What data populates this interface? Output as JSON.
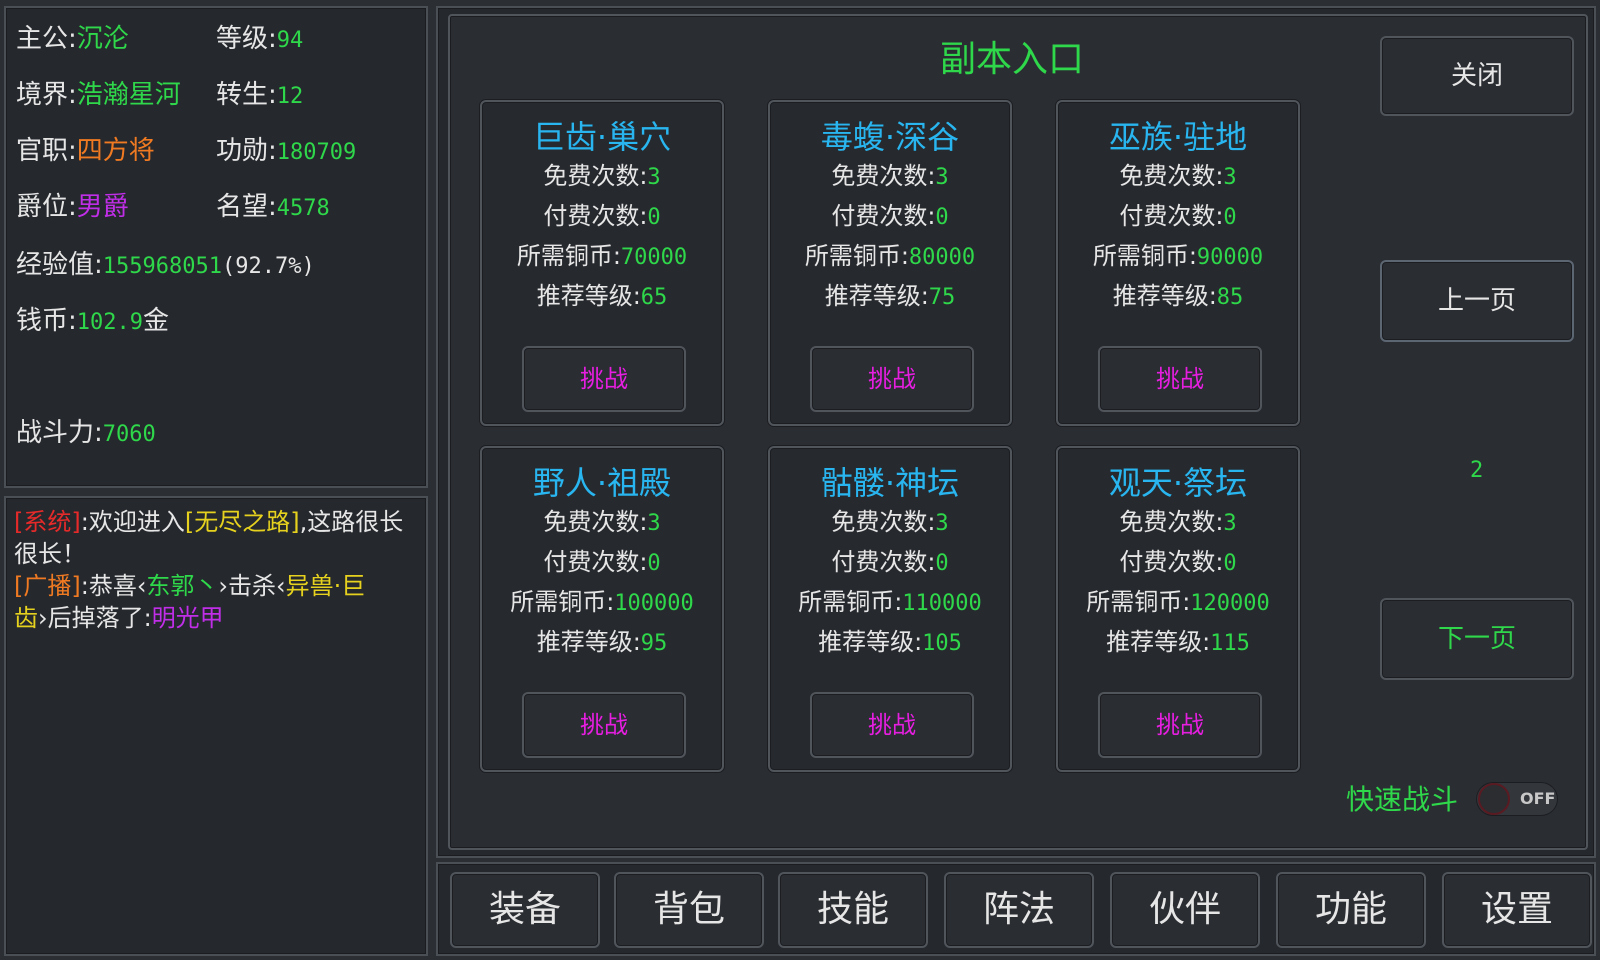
{
  "stats": {
    "lord_label": "主公:",
    "lord_value": "沉沦",
    "level_label": "等级:",
    "level_value": "94",
    "realm_label": "境界:",
    "realm_value": "浩瀚星河",
    "rebirth_label": "转生:",
    "rebirth_value": "12",
    "office_label": "官职:",
    "office_value": "四方将",
    "merit_label": "功勋:",
    "merit_value": "180709",
    "rank_label": "爵位:",
    "rank_value": "男爵",
    "fame_label": "名望:",
    "fame_value": "4578",
    "exp_label": "经验值:",
    "exp_value": "155968051",
    "exp_percent": "(92.7%)",
    "coin_label": "钱币:",
    "coin_value": "102.9",
    "coin_unit": "金",
    "power_label": "战斗力:",
    "power_value": "7060"
  },
  "chat": {
    "m1_tag": "[系统]",
    "m1_a": ":欢迎进入",
    "m1_hl": "[无尽之路]",
    "m1_b": ",这路很长很长！",
    "m2_tag": "[广播]",
    "m2_a": ":恭喜‹",
    "m2_name": "东郭丶",
    "m2_b": "›击杀‹",
    "m2_mob": "异兽·巨齿",
    "m2_c": "›后掉落了:",
    "m2_item": "明光甲"
  },
  "panel": {
    "title": "副本入口",
    "close_label": "关闭",
    "prev_label": "上一页",
    "next_label": "下一页",
    "page": "2",
    "fast_label": "快速战斗",
    "toggle_text": "OFF",
    "free_label": "免费次数:",
    "paid_label": "付费次数:",
    "cost_label": "所需铜币:",
    "level_label": "推荐等级:",
    "challenge_label": "挑战"
  },
  "dungeons": [
    {
      "name": "巨齿·巢穴",
      "free": "3",
      "paid": "0",
      "cost": "70000",
      "level": "65"
    },
    {
      "name": "毒蝮·深谷",
      "free": "3",
      "paid": "0",
      "cost": "80000",
      "level": "75"
    },
    {
      "name": "巫族·驻地",
      "free": "3",
      "paid": "0",
      "cost": "90000",
      "level": "85"
    },
    {
      "name": "野人·祖殿",
      "free": "3",
      "paid": "0",
      "cost": "100000",
      "level": "95"
    },
    {
      "name": "骷髅·神坛",
      "free": "3",
      "paid": "0",
      "cost": "110000",
      "level": "105"
    },
    {
      "name": "观天·祭坛",
      "free": "3",
      "paid": "0",
      "cost": "120000",
      "level": "115"
    }
  ],
  "tabs": [
    "装备",
    "背包",
    "技能",
    "阵法",
    "伙伴",
    "功能",
    "设置"
  ],
  "colors": {
    "green": "#2fd84a",
    "cyan": "#29b6f0",
    "magenta": "#e51ee0",
    "orange": "#f07a22",
    "purple": "#c02ee8",
    "red": "#e62a2a",
    "yellow": "#e6d21e"
  }
}
